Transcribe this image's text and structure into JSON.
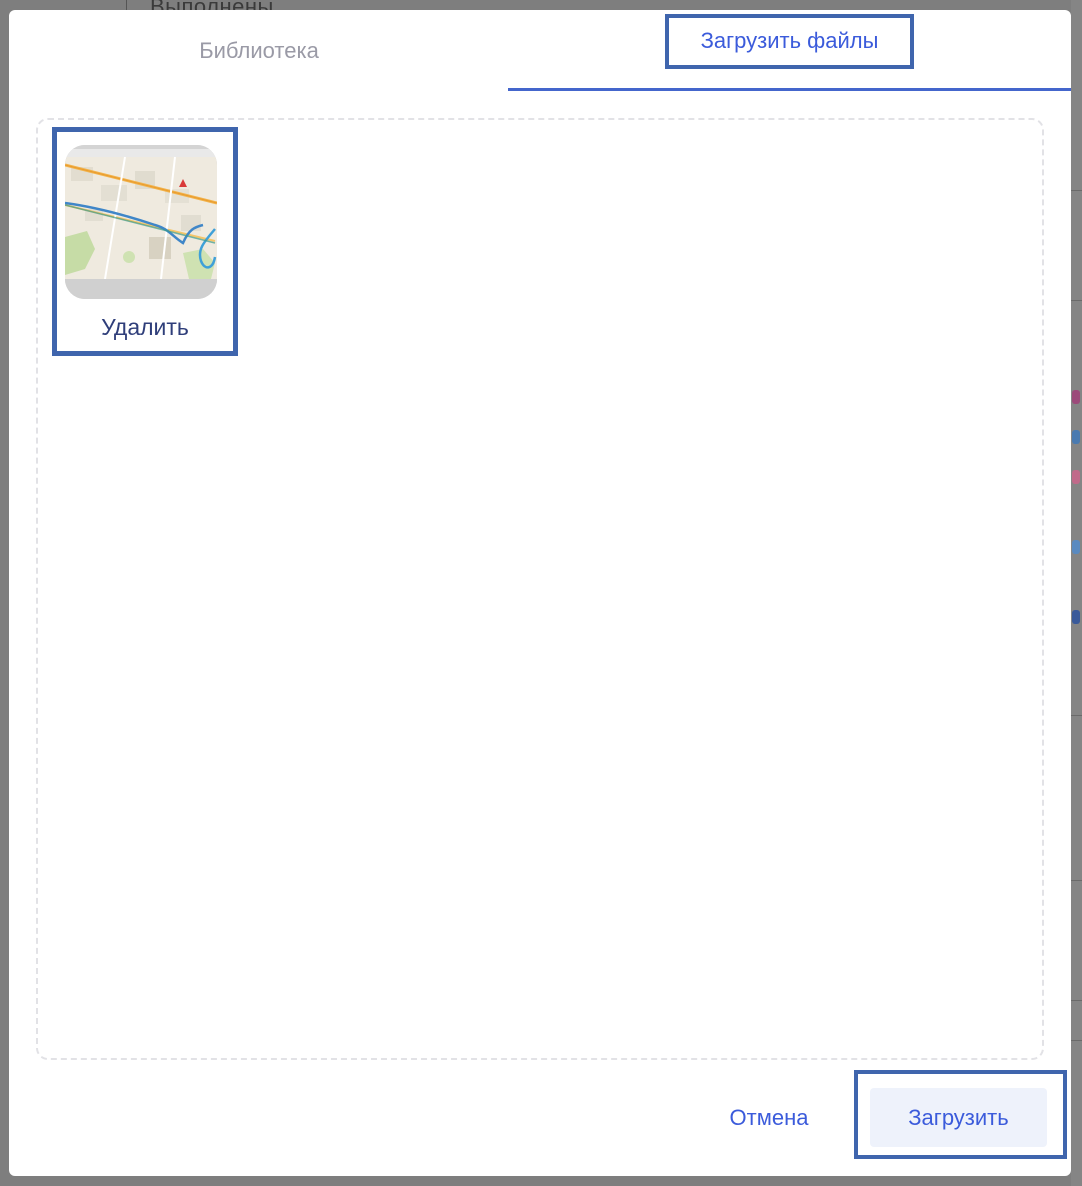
{
  "background": {
    "top_text": "Выполнены"
  },
  "modal": {
    "tabs": [
      {
        "label": "Библиотека",
        "active": false
      },
      {
        "label": "Загрузить файлы",
        "active": true
      }
    ],
    "files": [
      {
        "delete_label": "Удалить",
        "thumbnail": "map-screenshot"
      }
    ],
    "footer": {
      "cancel_label": "Отмена",
      "upload_label": "Загрузить"
    }
  },
  "colors": {
    "accent": "#3b5bdb",
    "highlight_frame": "#3f65ad",
    "inactive_tab": "#9a9aa6",
    "upload_button_bg": "#eef2fb"
  }
}
